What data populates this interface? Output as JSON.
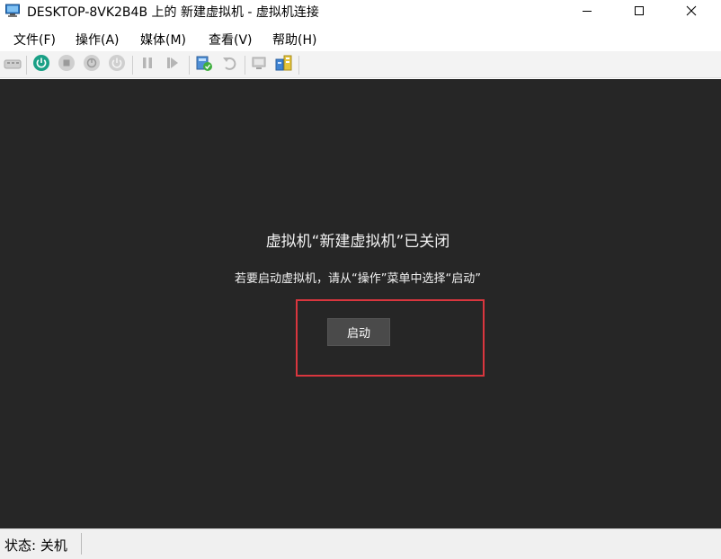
{
  "window": {
    "title": "DESKTOP-8VK2B4B 上的 新建虚拟机 - 虚拟机连接",
    "icons": [
      "vm-connection-icon",
      "minimize-icon",
      "maximize-icon",
      "close-icon"
    ]
  },
  "menu": {
    "items": [
      "文件(F)",
      "操作(A)",
      "媒体(M)",
      "查看(V)",
      "帮助(H)"
    ]
  },
  "toolbar": {
    "buttons": [
      "ctrl-alt-del-icon",
      "start-icon",
      "turn-off-icon",
      "shut-down-icon",
      "save-icon",
      "pause-icon",
      "reset-icon",
      "checkpoint-icon",
      "revert-icon",
      "enhanced-session-icon",
      "share-icon"
    ]
  },
  "vm_screen": {
    "heading": "虚拟机“新建虚拟机”已关闭",
    "instruction": "若要启动虚拟机，请从“操作”菜单中选择“启动”",
    "start_label": "启动"
  },
  "status": {
    "text": "状态: 关机"
  },
  "colors": {
    "screen_bg": "#262626",
    "start_power": "#1aa086",
    "highlight": "#d9363e"
  }
}
